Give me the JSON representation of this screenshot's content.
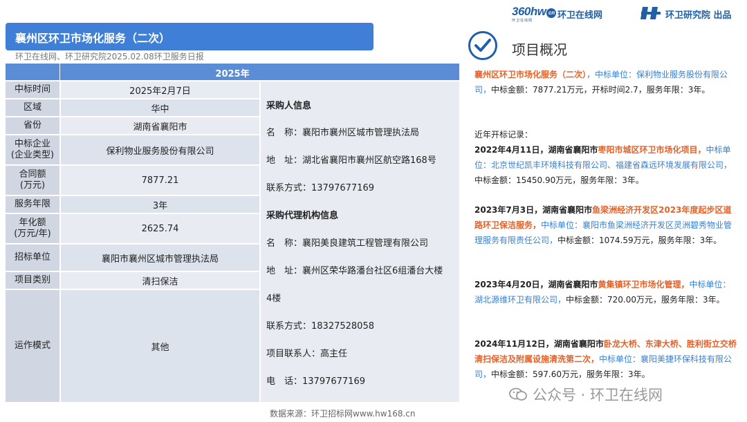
{
  "header": {
    "logo360_mark": "360hw",
    "logo360_badge": "cn",
    "logo360_sub": "环卫在线网",
    "logo360_name": "环卫在线网",
    "logo_hw_name": "环卫研究院 出品"
  },
  "title": "襄州区环卫市场化服务（二次）",
  "source_line": "环卫在线网、环卫研究院2025.02.08环卫服务日报",
  "table": {
    "year": "2025年",
    "rows": [
      {
        "key": "中标时间",
        "value": "2025年2月7日"
      },
      {
        "key": "区域",
        "value": "华中"
      },
      {
        "key": "省份",
        "value": "湖南省襄阳市"
      },
      {
        "key": "中标企业\n(企业类型)",
        "value": "保利物业服务股份有限公司"
      },
      {
        "key": "合同额\n(万元)",
        "value": "7877.21"
      },
      {
        "key": "服务年限",
        "value": "3年"
      },
      {
        "key": "年化额\n(万元/年)",
        "value": "2625.74"
      },
      {
        "key": "招标单位",
        "value": "襄阳市襄州区城市管理执法局"
      },
      {
        "key": "项目类别",
        "value": "清扫保洁"
      },
      {
        "key": "运作模式",
        "value": "其他"
      }
    ],
    "info": {
      "buyer_heading": "采购人信息",
      "buyer_name": "名　称：襄阳市襄州区城市管理执法局",
      "buyer_addr": "地　址：湖北省襄阳市襄州区航空路168号",
      "buyer_contact": "联系方式：13797677169",
      "agent_heading": "采购代理机构信息",
      "agent_name": "名　称：襄阳美良建筑工程管理有限公司",
      "agent_addr": "地　址：襄州区荣华路潘台社区6组潘台大楼",
      "agent_addr2": "4楼",
      "agent_contact": "联系方式：18327528058",
      "project_contact": "项目联系人：高主任",
      "phone": "电　话：13797677169"
    }
  },
  "footer_source": "数据来源：环卫招标网www.hw168.cn",
  "overview": {
    "title": "项目概况",
    "summary": {
      "project": "襄州区环卫市场化服务（二次）",
      "winner_prefix": "，中标单位：保利物业服务股份有限公司，",
      "rest": "中标金额：7877.21万元，开标时间2.7，服务年限：3年。"
    },
    "history_label": "近年开标记录：",
    "records": [
      {
        "date": "2022年4月11日，",
        "place": "湖南省襄阳市",
        "project": "枣阳市城区环卫市场化项目，",
        "winner": "中标单位：北京世纪凯丰环境科技有限公司、福建省森远环境发展有限公司，",
        "rest": "中标金额：15450.90万元，服务年限：3年。"
      },
      {
        "date": "2023年7月3日，",
        "place": "湖南省襄阳市",
        "project": "鱼梁洲经济开发区2023年度起步区道路环卫保洁服务，",
        "winner": "中标单位：襄阳市鱼梁洲经济开发区灵洲碧秀物业管理服务有限责任公司，",
        "rest": "中标金额：1074.59万元，服务年限：3年。"
      },
      {
        "date": "2023年4月20日，",
        "place": "湖南省襄阳市",
        "project": "黄集镇环卫市场化管理，",
        "winner": "中标单位：湖北源维环卫有限公司，",
        "rest": "中标金额：720.00万元，服务年限：3年。"
      },
      {
        "date": "2024年11月12日，",
        "place": "湖南省襄阳市",
        "project": "卧龙大桥、东津大桥、胜利街立交桥清扫保洁及附属设施清洗第二次，",
        "winner": "中标单位：襄阳美捷环保科技有限公司，",
        "rest": "中标金额：597.60万元，服务年限：3年。"
      }
    ]
  },
  "watermark": "公众号 · 环卫在线网",
  "colors": {
    "accent": "#3f7fd8",
    "highlight": "#e4622a",
    "link": "#3a7fd1"
  }
}
